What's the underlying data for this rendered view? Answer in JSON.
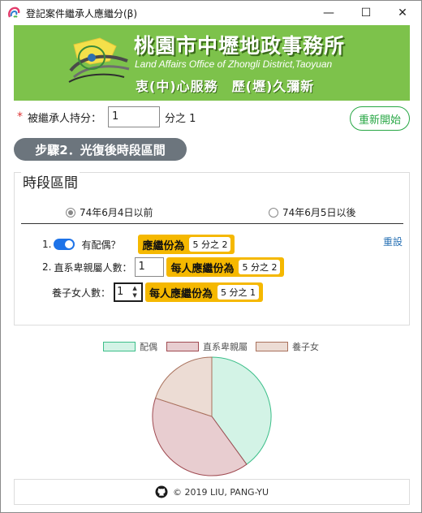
{
  "window": {
    "title": "登記案件繼承人應繼分(β)",
    "minimize_glyph": "—",
    "maximize_glyph": "☐",
    "close_glyph": "✕"
  },
  "banner": {
    "title": "桃園市中壢地政事務所",
    "subtitle": "Land Affairs Office of Zhongli District,Taoyuan",
    "slogan": "衷(中)心服務　歷(壢)久彌新",
    "background": "#7dc24b"
  },
  "share": {
    "required_mark": "*",
    "label": "被繼承人持分：",
    "value": "1",
    "suffix": "分之 1"
  },
  "restart_button": {
    "label": "重新開始",
    "color": "#28a745"
  },
  "step": {
    "label": "步驟2．光復後時段區間",
    "color": "#6c757d"
  },
  "period": {
    "legend": "時段區間",
    "options": [
      {
        "label": "74年6月4日以前",
        "checked": true
      },
      {
        "label": "74年6月5日以後",
        "checked": false
      }
    ],
    "reset_label": "重設",
    "spouse": {
      "index": "1.",
      "label": "有配偶？",
      "toggle_on": true,
      "result_label": "應繼份為",
      "result_value": "5 分之 2"
    },
    "lineal": {
      "index": "2.",
      "label": "直系卑親屬人數：",
      "value": "1",
      "result_label": "每人應繼份為",
      "result_value": "5 分之 2"
    },
    "adopted": {
      "label": "養子女人數：",
      "value": "1",
      "result_label": "每人應繼份為",
      "result_value": "5 分之 1"
    },
    "accent": "#f5b800"
  },
  "chart_data": {
    "type": "pie",
    "legend_position": "top",
    "series": [
      {
        "name": "配偶",
        "value": 0.4,
        "fill": "#d3f3e6",
        "stroke": "#3dbf8a"
      },
      {
        "name": "直系卑親屬",
        "value": 0.4,
        "fill": "#e8cdd0",
        "stroke": "#a04b52"
      },
      {
        "name": "養子女",
        "value": 0.2,
        "fill": "#ecdcd4",
        "stroke": "#a9725d"
      }
    ]
  },
  "footer": {
    "text": "© 2019 LIU, PANG-YU",
    "icon": "github-icon"
  }
}
